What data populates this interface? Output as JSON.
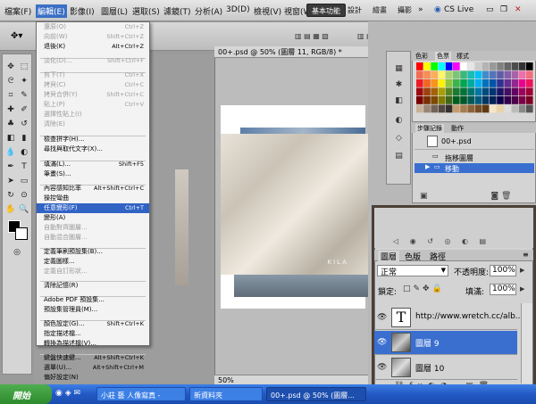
{
  "menubar": {
    "logo": "Ps",
    "items": [
      "檔案(F)",
      "編輯(E)",
      "影像(I)",
      "圖層(L)",
      "選取(S)",
      "濾鏡(T)",
      "分析(A)",
      "3D(D)",
      "檢視(V)",
      "視窗(W)",
      "說明(H)"
    ],
    "zoom": "50%",
    "workspaces": [
      "基本功能",
      "設計",
      "繪畫",
      "攝影"
    ],
    "cslive": "CS Live"
  },
  "edit_menu": {
    "rows": [
      {
        "label": "還原(O)",
        "shortcut": "Ctrl+Z",
        "disabled": true
      },
      {
        "label": "向前(W)",
        "shortcut": "Shift+Ctrl+Z",
        "disabled": true
      },
      {
        "label": "退後(K)",
        "shortcut": "Alt+Ctrl+Z",
        "disabled": false
      },
      {
        "label": "淡化(D)...",
        "shortcut": "Shift+Ctrl+F",
        "disabled": true
      },
      {
        "label": "剪下(T)",
        "shortcut": "Ctrl+X",
        "disabled": true
      },
      {
        "label": "拷貝(C)",
        "shortcut": "Ctrl+C",
        "disabled": true
      },
      {
        "label": "拷貝合併(Y)",
        "shortcut": "Shift+Ctrl+C",
        "disabled": true
      },
      {
        "label": "貼上(P)",
        "shortcut": "Ctrl+V",
        "disabled": true
      },
      {
        "label": "選擇性貼上(I)",
        "shortcut": "",
        "disabled": true
      },
      {
        "label": "清除(E)",
        "shortcut": "",
        "disabled": true
      },
      {
        "label": "檢查拼字(H)...",
        "shortcut": "",
        "disabled": false
      },
      {
        "label": "尋找與取代文字(X)...",
        "shortcut": "",
        "disabled": false
      },
      {
        "label": "填滿(L)...",
        "shortcut": "Shift+F5",
        "disabled": false
      },
      {
        "label": "筆畫(S)...",
        "shortcut": "",
        "disabled": false
      },
      {
        "label": "內容感知比率",
        "shortcut": "Alt+Shift+Ctrl+C",
        "disabled": false
      },
      {
        "label": "操控彎曲",
        "shortcut": "",
        "disabled": false
      },
      {
        "label": "任意變形(F)",
        "shortcut": "Ctrl+T",
        "disabled": false,
        "selected": true
      },
      {
        "label": "變形(A)",
        "shortcut": "",
        "disabled": false
      },
      {
        "label": "自動對齊圖層...",
        "shortcut": "",
        "disabled": true
      },
      {
        "label": "自動混合圖層...",
        "shortcut": "",
        "disabled": true
      },
      {
        "label": "定義筆刷預設集(B)...",
        "shortcut": "",
        "disabled": false
      },
      {
        "label": "定義圖樣...",
        "shortcut": "",
        "disabled": false
      },
      {
        "label": "定義自訂形狀...",
        "shortcut": "",
        "disabled": true
      },
      {
        "label": "清除記憶(R)",
        "shortcut": "",
        "disabled": false
      },
      {
        "label": "Adobe PDF 預設集...",
        "shortcut": "",
        "disabled": false
      },
      {
        "label": "預設集管理員(M)...",
        "shortcut": "",
        "disabled": false
      },
      {
        "label": "顏色設定(G)...",
        "shortcut": "Shift+Ctrl+K",
        "disabled": false
      },
      {
        "label": "指定描述檔...",
        "shortcut": "",
        "disabled": false
      },
      {
        "label": "轉換為描述檔(V)...",
        "shortcut": "",
        "disabled": false
      },
      {
        "label": "鍵盤快速鍵...",
        "shortcut": "Alt+Shift+Ctrl+K",
        "disabled": false
      },
      {
        "label": "選單(U)...",
        "shortcut": "Alt+Shift+Ctrl+M",
        "disabled": false
      },
      {
        "label": "偏好設定(N)",
        "shortcut": "",
        "disabled": false
      }
    ]
  },
  "document": {
    "tab_title": "00+.psd @ 50% (圖層 11, RGB/8) *",
    "zoom_status": "50%",
    "watermark": "KILA"
  },
  "swatch_panel": {
    "tabs": [
      "色彩",
      "色票",
      "樣式"
    ]
  },
  "history_panel": {
    "tabs": [
      "步驟記錄",
      "動作"
    ],
    "snapshot": "00+.psd",
    "items": [
      "拖移圖層",
      "移動"
    ]
  },
  "layers_panel": {
    "tabs": [
      "圖層",
      "色版",
      "路徑"
    ],
    "blend_mode": "正常",
    "opacity_label": "不透明度:",
    "opacity_value": "100%",
    "lock_label": "鎖定:",
    "fill_label": "填滿:",
    "fill_value": "100%",
    "layers": [
      {
        "name": "http://www.wretch.cc/alb...",
        "type": "text"
      },
      {
        "name": "圖層 9",
        "type": "image",
        "selected": true
      },
      {
        "name": "圖層 10",
        "type": "image"
      }
    ]
  },
  "taskbar": {
    "start_label": "開始",
    "tasks": [
      "小莊 藝 人像寫真 -",
      "新資料夾",
      "00+.psd @ 50% (圖層..."
    ]
  }
}
